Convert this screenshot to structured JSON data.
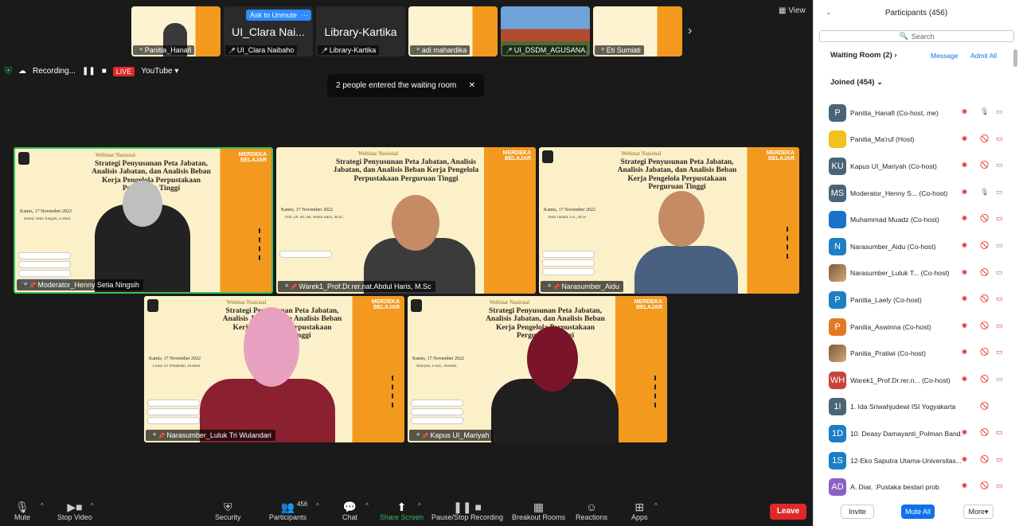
{
  "thumbnails": [
    {
      "name": "Panitia_Hanafi"
    },
    {
      "name": "UI_Clara Naibaho",
      "big": "UI_Clara Nai...",
      "ask": "Ask to Unmute",
      "more": "···"
    },
    {
      "name": "Library-Kartika",
      "big": "Library-Kartika"
    },
    {
      "name": "adi mahardika"
    },
    {
      "name": "UI_DSDM_AGUSANA..."
    },
    {
      "name": "Eti Sumiati"
    }
  ],
  "view_label": "View",
  "next_arrow": "›",
  "recording": {
    "label": "Recording...",
    "live": "LIVE",
    "platform": "YouTube"
  },
  "toast": {
    "text": "2 people entered the waiting room",
    "close": "✕"
  },
  "slide": {
    "webinar": "Webinar Nasional",
    "title": "Strategi Penyusunan Peta Jabatan, Analisis Jabatan, dan Analisis Beban Kerja Pengelola Perpustakaan Perguruan Tinggi",
    "date": "Kamis, 17 November 2022",
    "brand": "MERDEKA BELAJAR"
  },
  "tiles": [
    {
      "label": "Moderator_Henny Setia Ningsih",
      "speaker": "Henny Setia Ningsih, S.Hum."
    },
    {
      "label": "Warek1_Prof.Dr.rer.nat.Abdul Haris, M.Sc",
      "speaker": "Prof. Dr. rer. nat. Abdul Haris, M.Sc."
    },
    {
      "label": "Narasumber_Aidu",
      "speaker": "Aidu Tauhid, S.E., M.Si"
    },
    {
      "label": "Narasumber_Luluk Tri Wulandari",
      "speaker": "Luluk Tri Wulandari, M.Hum."
    },
    {
      "label": "Kapus UI_Mariyah",
      "speaker": "Mariyah, S.Sos., M.Hum."
    }
  ],
  "toolbar": {
    "mute": "Mute",
    "stop_video": "Stop Video",
    "security": "Security",
    "participants": "Participants",
    "participants_count": "456",
    "chat": "Chat",
    "share_screen": "Share Screen",
    "pause_recording": "Pause/Stop Recording",
    "breakout": "Breakout Rooms",
    "reactions": "Reactions",
    "apps": "Apps",
    "leave": "Leave"
  },
  "panel": {
    "title": "Participants (456)",
    "search_placeholder": "Search",
    "waiting_room": "Waiting Room (2)",
    "message": "Message",
    "admit_all": "Admit All",
    "joined": "Joined (454)",
    "invite": "Invite",
    "mute_all": "Mute All",
    "more": "More"
  },
  "participants": [
    {
      "initials": "P",
      "name": "Panitia_Hanafi (Co-host, me)",
      "mic": "on",
      "cam": "on",
      "avatar": "gray"
    },
    {
      "initials": "",
      "name": "Panitia_Ma'ruf (Host)",
      "mic": "muted",
      "cam": "off",
      "avatar": "yellow"
    },
    {
      "initials": "KU",
      "name": "Kapus UI_Mariyah (Co-host)",
      "mic": "muted",
      "cam": "on",
      "avatar": "gray"
    },
    {
      "initials": "MS",
      "name": "Moderator_Henny S... (Co-host)",
      "mic": "on",
      "cam": "on",
      "avatar": "gray"
    },
    {
      "initials": "",
      "name": "Muhammad Muadz (Co-host)",
      "mic": "muted",
      "cam": "off",
      "avatar": "blue"
    },
    {
      "initials": "N",
      "name": "Narasumber_Aidu (Co-host)",
      "mic": "muted",
      "cam": "on",
      "avatar": "teal"
    },
    {
      "initials": "",
      "name": "Narasumber_Luluk T... (Co-host)",
      "mic": "muted",
      "cam": "on",
      "avatar": "img"
    },
    {
      "initials": "P",
      "name": "Panitia_Laely (Co-host)",
      "mic": "muted",
      "cam": "off",
      "avatar": "teal"
    },
    {
      "initials": "P",
      "name": "Panitia_Aswinna (Co-host)",
      "mic": "muted",
      "cam": "off",
      "avatar": "orange"
    },
    {
      "initials": "",
      "name": "Panitia_Pratiwi (Co-host)",
      "mic": "muted",
      "cam": "off",
      "avatar": "img"
    },
    {
      "initials": "WH",
      "name": "Warek1_Prof.Dr.rer.n... (Co-host)",
      "mic": "muted",
      "cam": "on",
      "avatar": "red"
    },
    {
      "initials": "1I",
      "name": "1. Ida Sriwahjudewi ISI Yogyakarta",
      "mic": "muted",
      "cam": "none",
      "avatar": "gray"
    },
    {
      "initials": "1D",
      "name": "10. Deasy Damayanti_Polman Band...",
      "mic": "muted",
      "cam": "off",
      "avatar": "teal"
    },
    {
      "initials": "1S",
      "name": "12-Eko Saputra Utama-Universitas...",
      "mic": "muted",
      "cam": "off",
      "avatar": "teal"
    },
    {
      "initials": "AD",
      "name": "A. Diar, :Pustaka bestari prob",
      "mic": "muted",
      "cam": "off",
      "avatar": "purple"
    }
  ]
}
